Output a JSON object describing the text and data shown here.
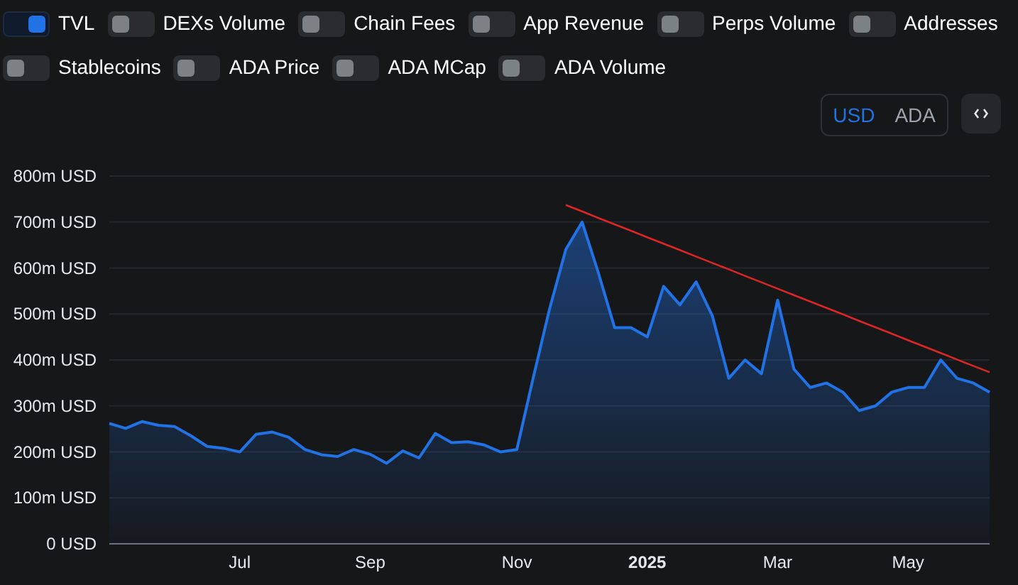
{
  "toggles": [
    {
      "label": "TVL",
      "on": true
    },
    {
      "label": "DEXs Volume",
      "on": false
    },
    {
      "label": "Chain Fees",
      "on": false
    },
    {
      "label": "App Revenue",
      "on": false
    },
    {
      "label": "Perps Volume",
      "on": false
    },
    {
      "label": "Addresses",
      "on": false
    },
    {
      "label": "Stablecoins",
      "on": false
    },
    {
      "label": "ADA Price",
      "on": false
    },
    {
      "label": "ADA MCap",
      "on": false
    },
    {
      "label": "ADA Volume",
      "on": false
    }
  ],
  "currency": [
    {
      "label": "USD",
      "selected": true
    },
    {
      "label": "ADA",
      "selected": false
    }
  ],
  "chart_data": {
    "type": "area",
    "grid": true,
    "ylim": [
      0,
      800
    ],
    "yticks": [
      {
        "value": 0,
        "label": "0 USD"
      },
      {
        "value": 100,
        "label": "100m USD"
      },
      {
        "value": 200,
        "label": "200m USD"
      },
      {
        "value": 300,
        "label": "300m USD"
      },
      {
        "value": 400,
        "label": "400m USD"
      },
      {
        "value": 500,
        "label": "500m USD"
      },
      {
        "value": 600,
        "label": "600m USD"
      },
      {
        "value": 700,
        "label": "700m USD"
      },
      {
        "value": 800,
        "label": "800m USD"
      }
    ],
    "categories": [
      null,
      null,
      null,
      null,
      null,
      null,
      null,
      null,
      "Jul",
      null,
      null,
      null,
      null,
      null,
      null,
      null,
      "Sep",
      null,
      null,
      null,
      null,
      null,
      null,
      null,
      null,
      "Nov",
      null,
      null,
      null,
      null,
      null,
      null,
      null,
      "2025",
      null,
      null,
      null,
      null,
      null,
      null,
      null,
      "Mar",
      null,
      null,
      null,
      null,
      null,
      null,
      null,
      "May",
      null,
      null,
      null,
      null,
      null
    ],
    "series": [
      {
        "color": "#2172e5",
        "values": [
          262,
          251,
          266,
          258,
          255,
          235,
          212,
          208,
          200,
          238,
          243,
          232,
          205,
          194,
          190,
          205,
          195,
          175,
          202,
          187,
          240,
          220,
          222,
          215,
          200,
          205,
          360,
          510,
          640,
          700,
          590,
          470,
          470,
          450,
          560,
          520,
          570,
          495,
          360,
          400,
          370,
          530,
          380,
          340,
          350,
          330,
          290,
          300,
          330,
          340,
          340,
          400,
          360,
          350,
          330
        ]
      },
      {
        "type": "line",
        "color": "#dc2626",
        "values": [
          null,
          null,
          null,
          null,
          null,
          null,
          null,
          null,
          null,
          null,
          null,
          null,
          null,
          null,
          null,
          null,
          null,
          null,
          null,
          null,
          null,
          null,
          null,
          null,
          null,
          null,
          null,
          null,
          737,
          723,
          709,
          695,
          681,
          667,
          653,
          639,
          625,
          611,
          597,
          583,
          569,
          555,
          541,
          527,
          513,
          499,
          485,
          471,
          457,
          443,
          429,
          415,
          401,
          387,
          373
        ]
      }
    ]
  }
}
